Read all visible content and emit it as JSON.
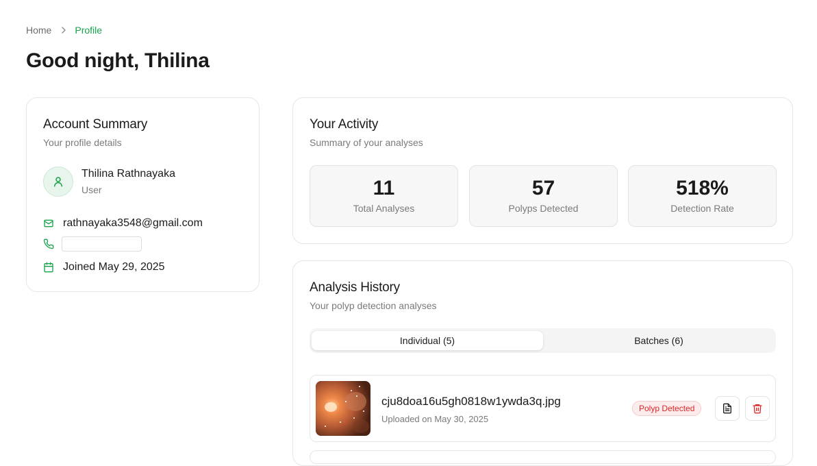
{
  "breadcrumb": {
    "home": "Home",
    "current": "Profile"
  },
  "page_title": "Good night, Thilina",
  "account": {
    "title": "Account Summary",
    "subtitle": "Your profile details",
    "name": "Thilina Rathnayaka",
    "role": "User",
    "email": "rathnayaka3548@gmail.com",
    "phone": "",
    "joined": "Joined May 29, 2025"
  },
  "activity": {
    "title": "Your Activity",
    "subtitle": "Summary of your analyses",
    "stats": [
      {
        "value": "11",
        "label": "Total Analyses"
      },
      {
        "value": "57",
        "label": "Polyps Detected"
      },
      {
        "value": "518%",
        "label": "Detection Rate"
      }
    ]
  },
  "history": {
    "title": "Analysis History",
    "subtitle": "Your polyp detection analyses",
    "tabs": [
      {
        "label": "Individual (5)",
        "active": true
      },
      {
        "label": "Batches (6)",
        "active": false
      }
    ],
    "items": [
      {
        "file_name": "cju8doa16u5gh0818w1ywda3q.jpg",
        "uploaded": "Uploaded on May 30, 2025",
        "status": "Polyp Detected"
      }
    ]
  },
  "colors": {
    "accent": "#16a34a",
    "danger": "#dc2626",
    "border": "#e6e6e6"
  }
}
